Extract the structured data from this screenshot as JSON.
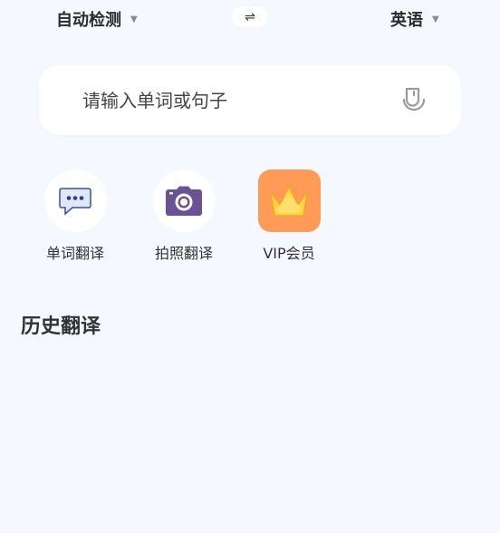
{
  "language_bar": {
    "source_language": "自动检测",
    "target_language": "英语",
    "swap_glyph": "⇌"
  },
  "search": {
    "placeholder": "请输入单词或句子",
    "value": ""
  },
  "tools": [
    {
      "label": "单词翻译",
      "icon": "chat-bubble-icon"
    },
    {
      "label": "拍照翻译",
      "icon": "camera-icon"
    },
    {
      "label": "VIP会员",
      "icon": "crown-icon"
    }
  ],
  "history": {
    "title": "历史翻译"
  },
  "colors": {
    "background": "#f5f8fe",
    "vip_orange": "#ff9b56",
    "crown_gold": "#ffd43b",
    "camera_purple": "#6b5294",
    "chat_blue": "#2c3f8f"
  }
}
